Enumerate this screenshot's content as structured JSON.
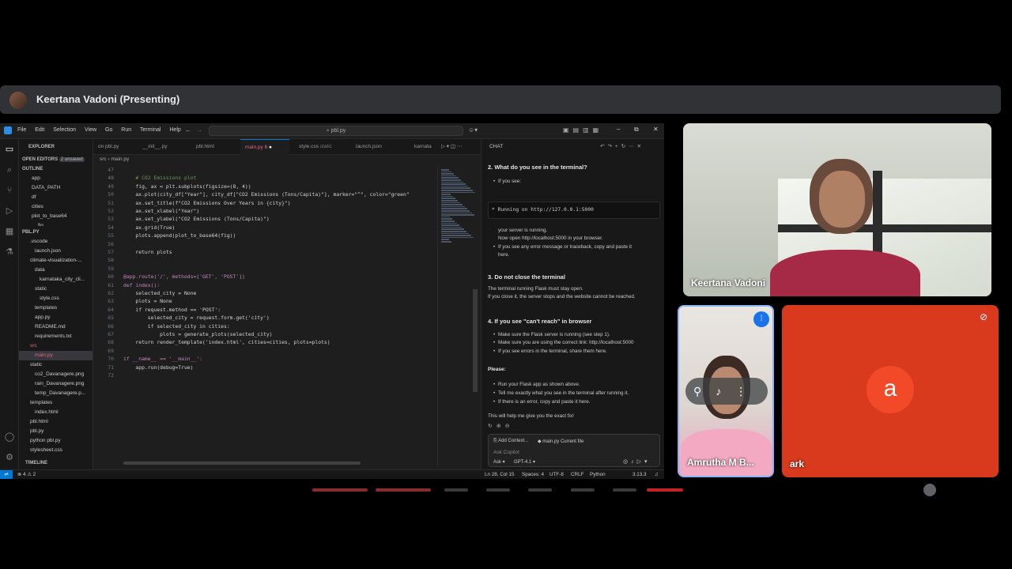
{
  "meet": {
    "presenter_title": "Keertana Vadoni (Presenting)",
    "tiles": [
      {
        "name": "Keertana Vadoni"
      },
      {
        "name": "Amrutha M B..."
      },
      {
        "name": "ark",
        "avatar_letter": "a"
      }
    ]
  },
  "vscode": {
    "menu": [
      "File",
      "Edit",
      "Selection",
      "View",
      "Go",
      "Run",
      "Terminal",
      "Help"
    ],
    "search": "pbl.py",
    "sidebar": {
      "explorer_label": "EXPLORER",
      "open_editors": "OPEN EDITORS",
      "unsaved": "2 unsaved",
      "outline": "OUTLINE",
      "outline_items": [
        "app",
        "DATA_PATH",
        "df",
        "cities",
        "plot_to_base64",
        "fig"
      ],
      "project": "PBL.PY",
      "tree": [
        ".vscode",
        "launch.json",
        "climate-visualization-...",
        "data",
        "karnataka_city_cli...",
        "static",
        "style.css",
        "templates",
        "app.py",
        "README.md",
        "requirements.txt",
        "src",
        "main.py",
        "static",
        "co2_Davanagere.png",
        "rain_Davanagere.png",
        "temp_Davanagere.p...",
        "templates",
        "index.html",
        "pbl.html",
        "pbl.py",
        "python pbl.py",
        "stylesheet.css"
      ],
      "timeline": "TIMELINE"
    },
    "tabs": [
      "on pbl.py",
      "__init__.py",
      "pbl.html",
      "main.py",
      "style.css",
      "launch.json",
      "karnata"
    ],
    "tab_static": "static",
    "tab_badge": "6",
    "breadcrumb": [
      "src",
      "main.py"
    ],
    "code_lines": [
      {
        "n": "47",
        "t": ""
      },
      {
        "n": "48",
        "t": "    # CO2 Emissions plot"
      },
      {
        "n": "49",
        "t": "    fig, ax = plt.subplots(figsize=(8, 4))"
      },
      {
        "n": "50",
        "t": "    ax.plot(city_df[\"Year\"], city_df[\"CO2 Emissions (Tons/Capita)\"], marker=\"^\", color=\"green\""
      },
      {
        "n": "51",
        "t": "    ax.set_title(f\"CO2 Emissions Over Years in {city}\")"
      },
      {
        "n": "52",
        "t": "    ax.set_xlabel(\"Year\")"
      },
      {
        "n": "53",
        "t": "    ax.set_ylabel(\"CO2 Emissions (Tons/Capita)\")"
      },
      {
        "n": "54",
        "t": "    ax.grid(True)"
      },
      {
        "n": "55",
        "t": "    plots.append(plot_to_base64(fig))"
      },
      {
        "n": "56",
        "t": ""
      },
      {
        "n": "57",
        "t": "    return plots"
      },
      {
        "n": "58",
        "t": ""
      },
      {
        "n": "59",
        "t": ""
      },
      {
        "n": "60",
        "t": "@app.route('/', methods=['GET', 'POST'])"
      },
      {
        "n": "61",
        "t": "def index():"
      },
      {
        "n": "62",
        "t": "    selected_city = None"
      },
      {
        "n": "63",
        "t": "    plots = None"
      },
      {
        "n": "64",
        "t": "    if request.method == 'POST':"
      },
      {
        "n": "65",
        "t": "        selected_city = request.form.get('city')"
      },
      {
        "n": "66",
        "t": "        if selected_city in cities:"
      },
      {
        "n": "67",
        "t": "            plots = generate_plots(selected_city)"
      },
      {
        "n": "68",
        "t": "    return render_template('index.html', cities=cities, plots=plots)"
      },
      {
        "n": "69",
        "t": ""
      },
      {
        "n": "70",
        "t": "if __name__ == '__main__':"
      },
      {
        "n": "71",
        "t": "    app.run(debug=True)"
      },
      {
        "n": "72",
        "t": ""
      }
    ],
    "chat": {
      "title": "CHAT",
      "s2": "2. What do you see in the terminal?",
      "s2_if": "If you see:",
      "s2_code": "* Running on http://127.0.0.1:5000",
      "s2_a": "your server is running.",
      "s2_b": "Now open http://localhost:5000 in your browser.",
      "s2_c": "If you see any error message or traceback, copy and paste it",
      "s2_c2": "here.",
      "s3": "3. Do not close the terminal",
      "s3_a": "The terminal running Flask must stay open.",
      "s3_b": "If you close it, the server stops and the website cannot be reached.",
      "s4": "4. If you see \"can't reach\" in browser",
      "s4_a": "Make sure the Flask server is running (see step 1).",
      "s4_b": "Make sure you are using the correct link: http://localhost:5000",
      "s4_c": "If you see errors in the terminal, share them here.",
      "please": "Please:",
      "p_a": "Run your Flask app as shown above.",
      "p_b": "Tell me exactly what you see in the terminal after running it.",
      "p_c": "If there is an error, copy and paste it here.",
      "end": "This will help me give you the exact fix!",
      "add_context": "Add Context...",
      "current_file": "main.py  Current file",
      "placeholder": "Ask Copilot",
      "mode": "Ask",
      "model": "GPT-4.1"
    },
    "status": {
      "left": "⊗ 4 ⚠ 2",
      "pos": "Ln 28, Col 15",
      "spaces": "Spaces: 4",
      "enc": "UTF-8",
      "eol": "CRLF",
      "lang": "Python",
      "ver": "3.13.3"
    }
  }
}
